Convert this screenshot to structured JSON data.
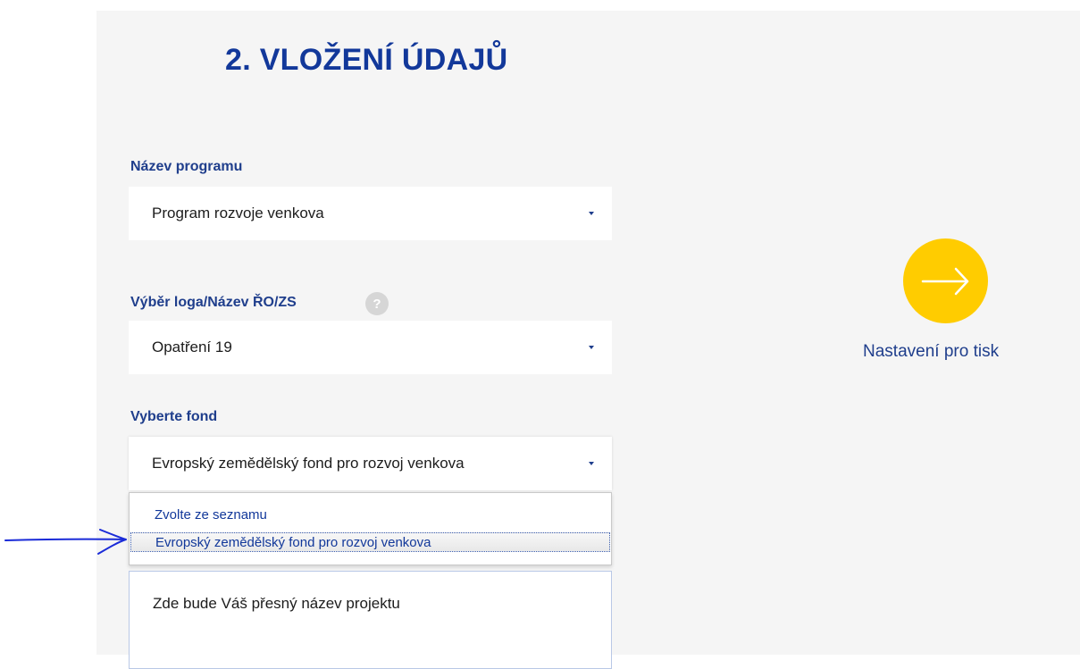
{
  "page": {
    "title": "2. VLOŽENÍ ÚDAJŮ"
  },
  "fields": {
    "program": {
      "label": "Název programu",
      "value": "Program rozvoje venkova"
    },
    "logo": {
      "label": "Výběr loga/Název ŘO/ZS",
      "help_icon": "?",
      "value": "Opatření 19"
    },
    "fund": {
      "label": "Vyberte fond",
      "value": "Evropský zemědělský fond pro rozvoj venkova",
      "options": [
        "Zvolte ze seznamu",
        "Evropský zemědělský fond pro rozvoj venkova"
      ]
    },
    "project_name": {
      "value": "Zde bude Váš přesný název projektu"
    }
  },
  "next": {
    "label": "Nastavení pro tisk",
    "icon": "arrow-right-icon"
  },
  "colors": {
    "accent": "#ffcc00",
    "title": "#12389a",
    "label": "#1f3e8c",
    "annotation": "#1a2bd8"
  }
}
